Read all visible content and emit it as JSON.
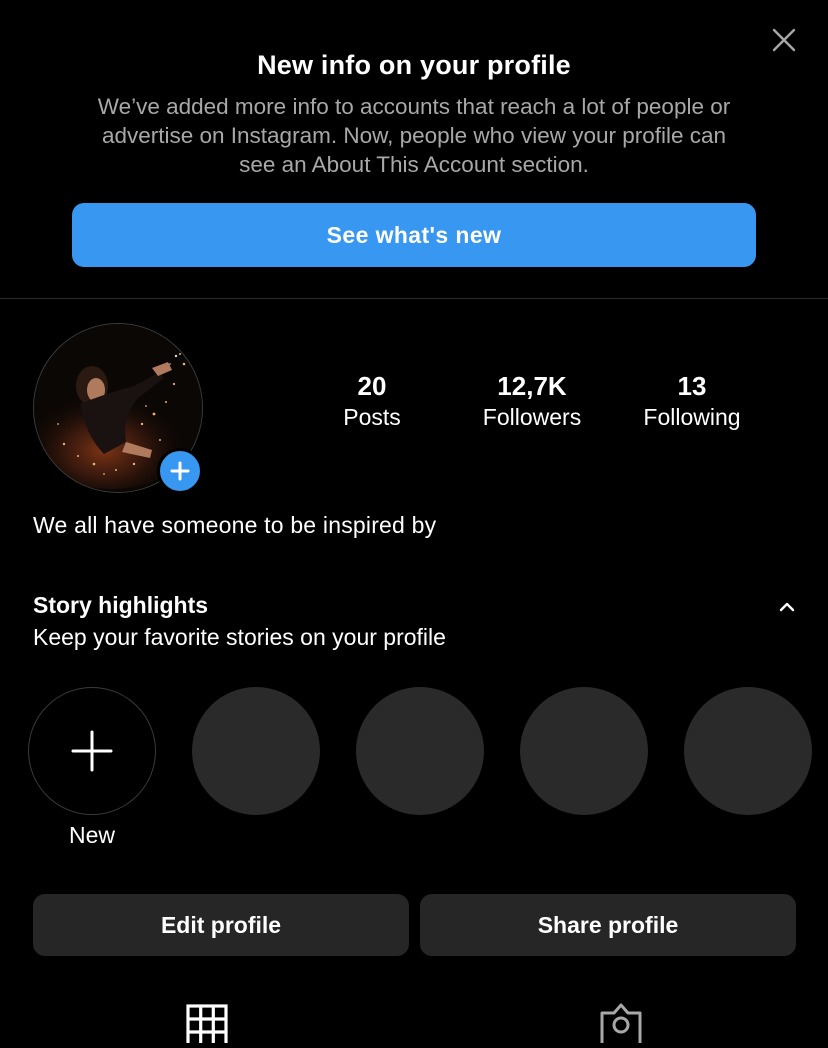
{
  "banner": {
    "title": "New info on your profile",
    "body": "We’ve added more info to accounts that reach a lot of people or advertise on Instagram. Now, people who view your profile can see an About This Account section.",
    "cta_label": "See what's new",
    "close_icon": "close-icon"
  },
  "profile": {
    "avatar_icon": "profile-photo",
    "add_story_icon": "plus-icon",
    "stats": {
      "posts": {
        "value": "20",
        "label": "Posts"
      },
      "followers": {
        "value": "12,7K",
        "label": "Followers"
      },
      "following": {
        "value": "13",
        "label": "Following"
      }
    },
    "bio": "We all have someone to be inspired by"
  },
  "highlights": {
    "title": "Story highlights",
    "subtitle": "Keep your favorite stories on your profile",
    "new_label": "New",
    "collapse_icon": "chevron-up-icon"
  },
  "actions": {
    "edit_label": "Edit profile",
    "share_label": "Share profile"
  },
  "tabs": {
    "grid_icon": "grid-icon",
    "tagged_icon": "tagged-icon"
  },
  "colors": {
    "background": "#000000",
    "accent": "#3897f0",
    "button_bg": "#262626",
    "secondary_text": "#a8a8a8",
    "placeholder_circle": "#2a2a2a"
  }
}
